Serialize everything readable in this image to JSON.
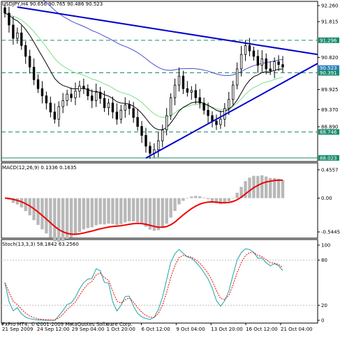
{
  "chart_data": {
    "type": "candlestick",
    "symbol_header": "USDJPY,H4  90.656 90.765 90.486 90.523",
    "price_axis_ticks": [
      "92.260",
      "91.815",
      "91.296",
      "90.820",
      "90.523",
      "90.391",
      "89.925",
      "89.370",
      "88.890",
      "88.746",
      "88.023"
    ],
    "price_ylim": [
      88.0,
      92.3
    ],
    "time_axis_labels": [
      "21 Sep 2009",
      "24 Sep 12:00",
      "29 Sep 04:00",
      "1 Oct 20:00",
      "6 Oct 12:00",
      "9 Oct 04:00",
      "13 Oct 20:00",
      "16 Oct 12:00",
      "21 Oct 04:00"
    ],
    "horizontal_levels": [
      {
        "value": 91.296,
        "label": "91.296"
      },
      {
        "value": 90.391,
        "label": "90.391"
      },
      {
        "value": 88.746,
        "label": "88.746"
      },
      {
        "value": 88.023,
        "label": "88.023"
      }
    ],
    "current_price": "90.523",
    "close_prices": [
      92.05,
      91.72,
      91.35,
      91.5,
      91.15,
      90.85,
      90.55,
      90.2,
      89.95,
      89.75,
      89.55,
      89.3,
      89.1,
      89.45,
      89.62,
      89.8,
      89.7,
      89.88,
      90.02,
      89.95,
      89.75,
      89.62,
      89.85,
      89.68,
      89.42,
      89.55,
      89.3,
      89.1,
      89.35,
      89.5,
      89.4,
      89.15,
      88.9,
      88.65,
      88.35,
      88.15,
      88.25,
      88.5,
      88.8,
      89.2,
      89.7,
      90.05,
      90.3,
      89.95,
      89.85,
      89.9,
      89.7,
      89.55,
      89.35,
      89.2,
      89.05,
      88.95,
      89.1,
      89.4,
      89.65,
      90.05,
      90.5,
      90.9,
      91.15,
      91.0,
      90.85,
      90.6,
      90.78,
      90.5,
      90.45,
      90.7,
      90.62,
      90.55
    ],
    "indicators": [
      {
        "name": "MACD(12,26,9)",
        "header": "MACD(12,26,9)  0.1336  0.1635",
        "ticks": [
          "0.4557",
          "0.00",
          "-0.5445"
        ],
        "ylim": [
          -0.6,
          0.5
        ]
      },
      {
        "name": "Stoch(13,3,3)",
        "header": "Stoch(13,3,3)  58.1842  63.2560",
        "ticks": [
          "100",
          "80",
          "20",
          "0"
        ],
        "ylim": [
          0,
          100
        ]
      }
    ],
    "footer": "FxPro MT4, © 2001-2009 MetaQuotes Software Corp.",
    "colors": {
      "trendline": "#0000cc",
      "ma_blue": "#4b4bd6",
      "ma_green": "#7fe08a",
      "ma_black": "#000000",
      "candle_up": "#ffffff",
      "candle_down": "#000000",
      "hline": "#1a8a6e",
      "macd_hist": "#b8b8b8",
      "macd_signal": "#ee0000",
      "stoch_main": "#1fa3a3",
      "stoch_signal": "#ee0000",
      "price_box": "#2a7fbf"
    }
  }
}
